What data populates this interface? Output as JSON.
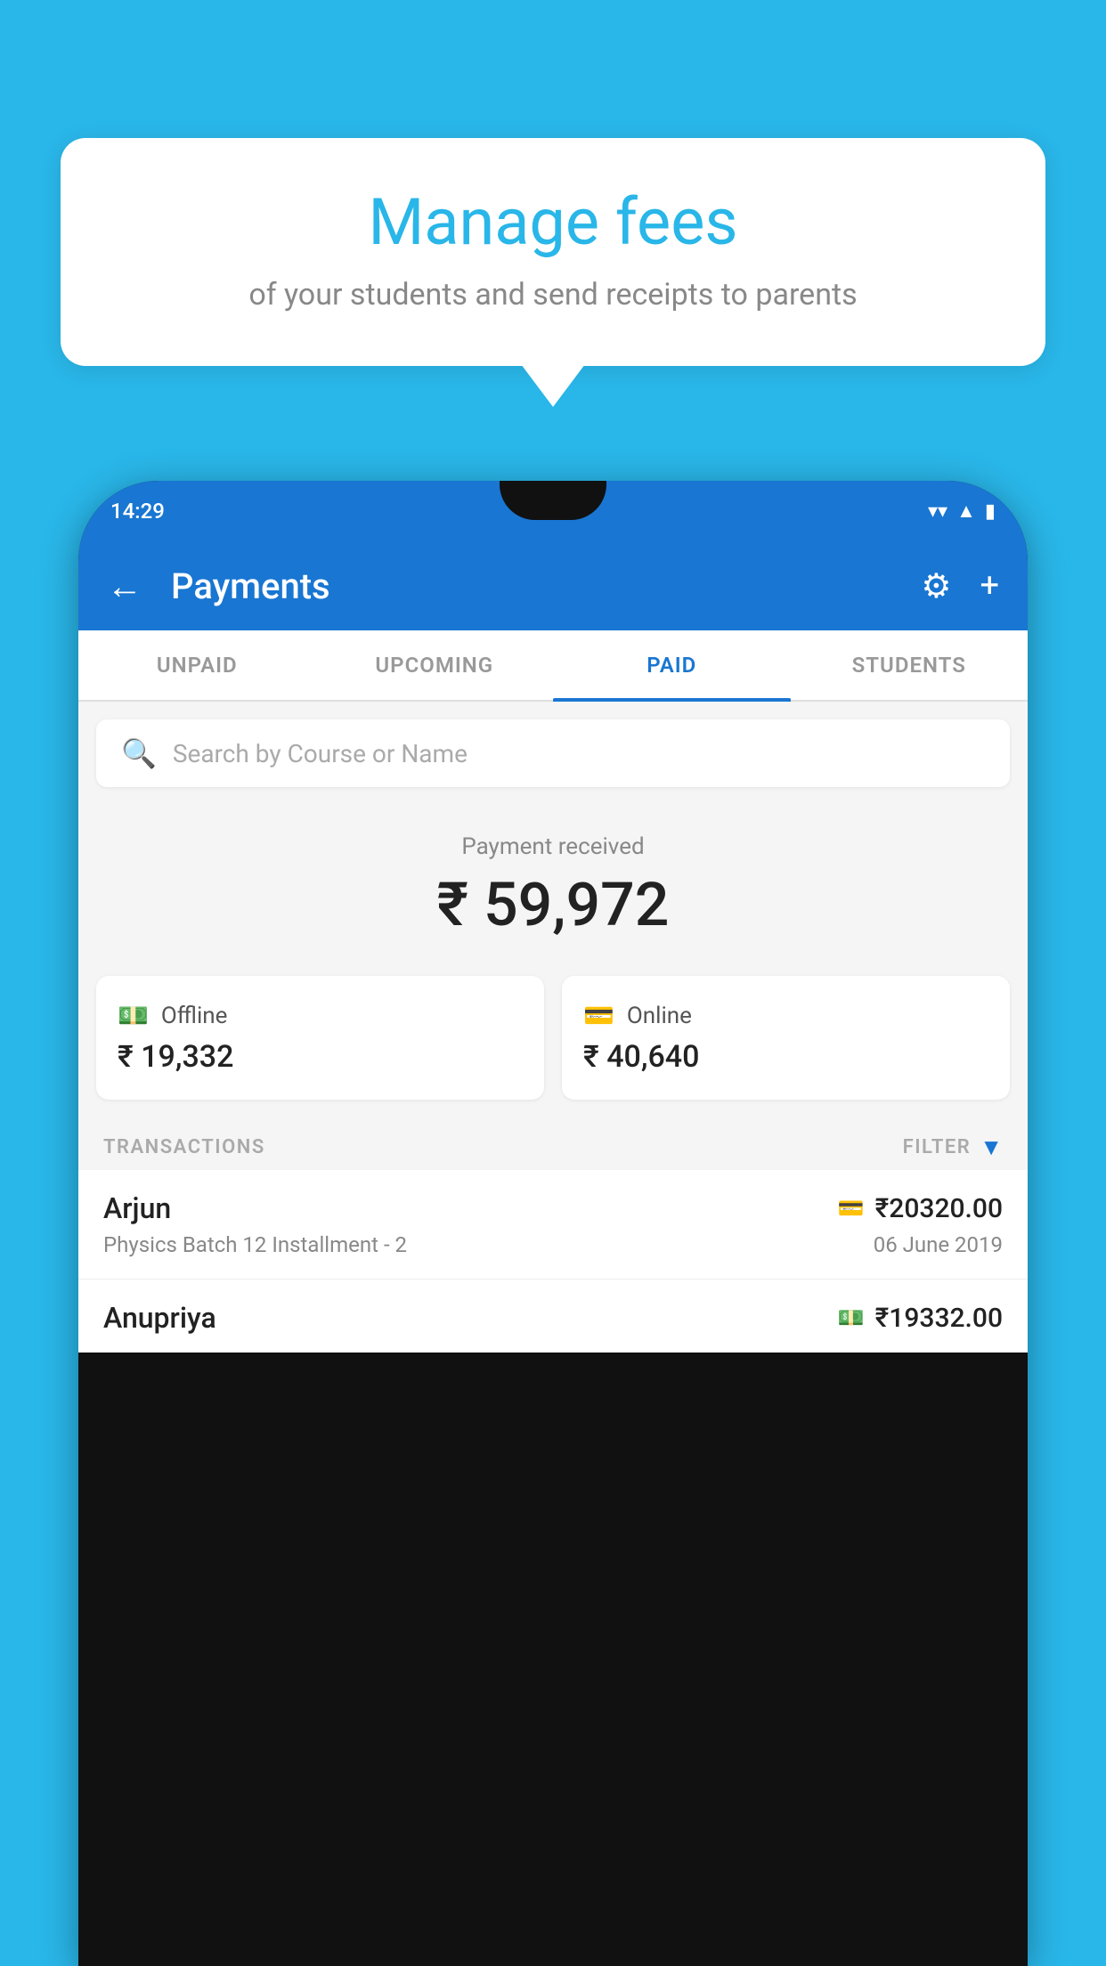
{
  "background_color": "#29B6E8",
  "tooltip": {
    "title": "Manage fees",
    "subtitle": "of your students and send receipts to parents"
  },
  "status_bar": {
    "time": "14:29",
    "icons": [
      "wifi",
      "signal",
      "battery"
    ]
  },
  "header": {
    "title": "Payments",
    "back_label": "←",
    "gear_label": "⚙",
    "plus_label": "+"
  },
  "tabs": [
    {
      "label": "UNPAID",
      "active": false
    },
    {
      "label": "UPCOMING",
      "active": false
    },
    {
      "label": "PAID",
      "active": true
    },
    {
      "label": "STUDENTS",
      "active": false
    }
  ],
  "search": {
    "placeholder": "Search by Course or Name"
  },
  "payment_summary": {
    "label": "Payment received",
    "amount": "₹ 59,972",
    "offline_label": "Offline",
    "offline_amount": "₹ 19,332",
    "online_label": "Online",
    "online_amount": "₹ 40,640"
  },
  "transactions_section": {
    "label": "TRANSACTIONS",
    "filter_label": "FILTER"
  },
  "transactions": [
    {
      "name": "Arjun",
      "course": "Physics Batch 12 Installment - 2",
      "amount": "₹20320.00",
      "date": "06 June 2019",
      "payment_type": "card"
    },
    {
      "name": "Anupriya",
      "course": "",
      "amount": "₹19332.00",
      "date": "",
      "payment_type": "cash"
    }
  ]
}
